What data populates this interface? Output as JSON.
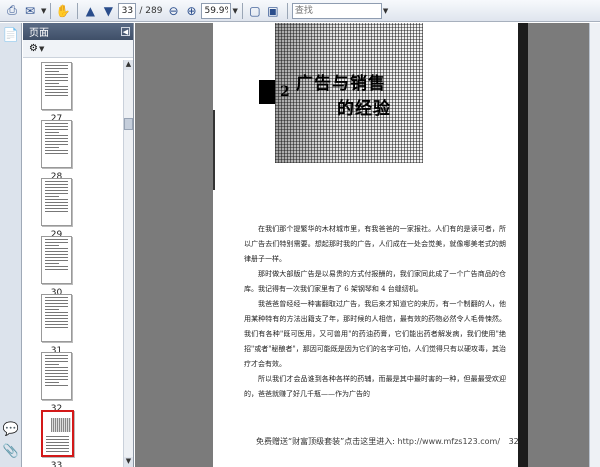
{
  "toolbar": {
    "page_current": "33",
    "page_total": "/ 289",
    "zoom": "59.9%",
    "search_placeholder": "查找"
  },
  "panel": {
    "title": "页面",
    "thumbs": [
      "27",
      "28",
      "29",
      "30",
      "31",
      "32",
      "33"
    ],
    "selected": "33"
  },
  "page": {
    "chapter_number": "2",
    "chapter_title_line1": "广告与销售",
    "chapter_title_line2": "的经验",
    "paragraphs": [
      "在我们那个提繁华的木材城市里，有我爸爸的一家报社。人们有的是读可者，所以广告去们特别需要。想起那时我的广告，人们成在一处会觉美，就像哪美老式的朗律册子一样。",
      "那时做大部版广告是以易贵的方式付报酬的，我们家同此成了一个广告商品的仓库。我记得有一次我们家里有了 6 架钢琴和 4 台缝纫机。",
      "我爸爸曾经经一种害翻取过广告，我后来才知道它的来历，有一个制翻的人，他用某种特有的方法出籍支了年，那时候的人相信，最有效的药物必然令人毛骨悚然。我们有各种\"既可医用，又可兽用\"的药油药膏，它们能出药者解发病，我们使用\"绝招\"或者\"秘酿者\"，那因可能既是因为它们的名字可怕，人们觉得只有以硬攻毒，其治疗才会有效。",
      "所以我们才会品谁到各种各样的药辅，而最是其中最时害的一种，但最最受欢迎的，爸爸就赚了好几千瓶——作为广告的"
    ],
    "footer_text": "免费赠送“财富顶级套装”点击这里进入:",
    "footer_link": "http://www.mfzs123.com/",
    "footer_page": "32"
  }
}
